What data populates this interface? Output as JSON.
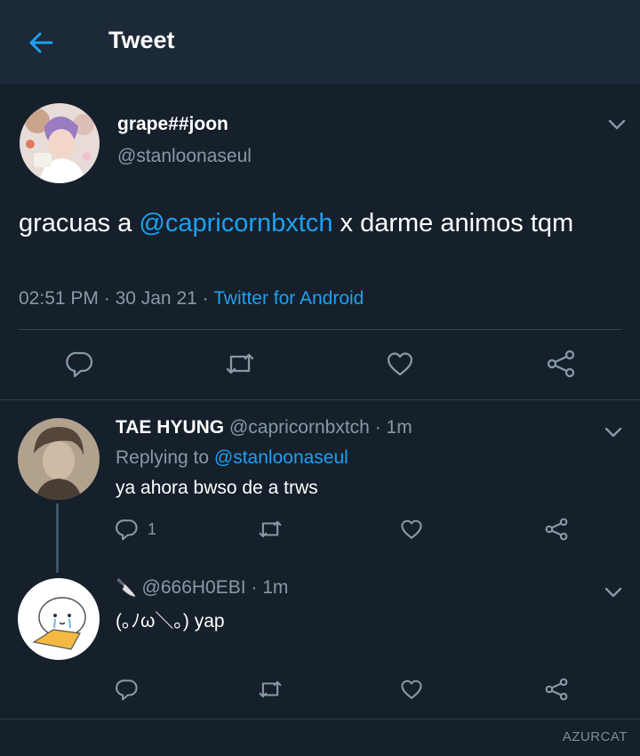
{
  "header": {
    "title": "Tweet",
    "back_icon": "arrow-left-icon",
    "accent": "#1da1f2"
  },
  "main_tweet": {
    "name": "grape##joon",
    "handle": "@stanloonaseul",
    "text_before": "gracuas a ",
    "mention": "@capricornbxtch",
    "text_after": " x darme animos tqm",
    "time": "02:51 PM",
    "date": "30 Jan 21",
    "sep": " · ",
    "source": "Twitter for Android"
  },
  "reply1": {
    "name": "TAE HYUNG",
    "handle": "@capricornbxtch",
    "time_sep": " · ",
    "time": "1m",
    "replying_label": "Replying to ",
    "replying_to": "@stanloonaseul",
    "text": "ya ahora bwso de a trws",
    "reply_count": "1"
  },
  "reply2": {
    "name_emoji": "🔪",
    "handle": "@666H0EBI",
    "time_sep": " · ",
    "time": "1m",
    "text": "(｡ﾉω＼｡) yap"
  },
  "watermark": "AZURCAT",
  "icons": {
    "reply": "reply-icon",
    "retweet": "retweet-icon",
    "like": "heart-icon",
    "share": "share-icon",
    "chevron": "chevron-down-icon"
  }
}
